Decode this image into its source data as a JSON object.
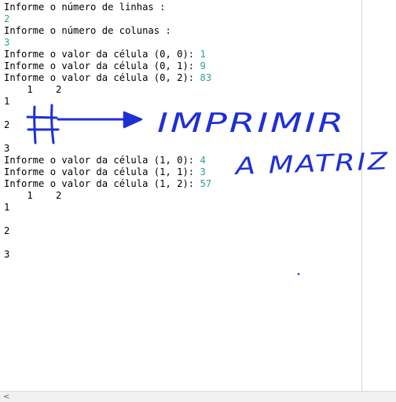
{
  "console": {
    "lines": [
      {
        "text": "Informe o número de linhas :",
        "value": ""
      },
      {
        "text": "",
        "value": "2"
      },
      {
        "text": "Informe o número de colunas :",
        "value": ""
      },
      {
        "text": "",
        "value": "3"
      },
      {
        "text": "Informe o valor da célula (0, 0): ",
        "value": "1"
      },
      {
        "text": "Informe o valor da célula (0, 1): ",
        "value": "9"
      },
      {
        "text": "Informe o valor da célula (0, 2): ",
        "value": "83"
      },
      {
        "text": "    1    2",
        "value": ""
      },
      {
        "text": "1",
        "value": ""
      },
      {
        "text": "2",
        "value": ""
      },
      {
        "text": "3",
        "value": ""
      },
      {
        "text": "Informe o valor da célula (1, 0): ",
        "value": "4"
      },
      {
        "text": "Informe o valor da célula (1, 1): ",
        "value": "3"
      },
      {
        "text": "Informe o valor da célula (1, 2): ",
        "value": "57"
      },
      {
        "text": "    1    2",
        "value": ""
      },
      {
        "text": "1",
        "value": ""
      },
      {
        "text": "2",
        "value": ""
      },
      {
        "text": "3",
        "value": ""
      }
    ]
  },
  "annotation": {
    "line1": "IMPRIMIR",
    "line2": "A MATRIZ",
    "ink_color": "#1f2fd6"
  },
  "scrollbar": {
    "left_arrow": "<"
  },
  "colors": {
    "input_value": "#2aa198"
  }
}
